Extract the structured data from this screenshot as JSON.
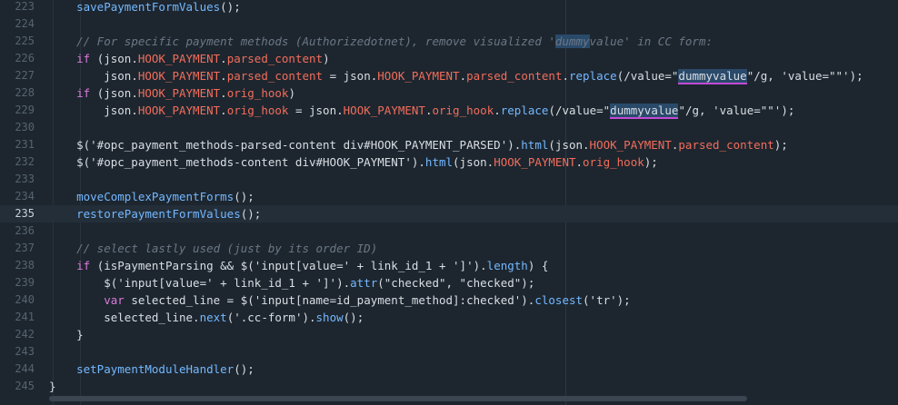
{
  "editor": {
    "lines": [
      {
        "num": "223",
        "tokens": [
          [
            "pn",
            "    "
          ],
          [
            "fn",
            "savePaymentFormValues"
          ],
          [
            "pn",
            "();"
          ]
        ]
      },
      {
        "num": "224",
        "tokens": []
      },
      {
        "num": "225",
        "tokens": [
          [
            "pn",
            "    "
          ],
          [
            "cm",
            "// For specific payment methods (Authorizedotnet), remove visualized '"
          ],
          [
            "cm-hl",
            "dummy"
          ],
          [
            "cm",
            "value' in CC form:"
          ]
        ]
      },
      {
        "num": "226",
        "tokens": [
          [
            "pn",
            "    "
          ],
          [
            "kw",
            "if"
          ],
          [
            "pn",
            " (json."
          ],
          [
            "prop",
            "HOOK_PAYMENT"
          ],
          [
            "pn",
            "."
          ],
          [
            "prop",
            "parsed_content"
          ],
          [
            "pn",
            ")"
          ]
        ]
      },
      {
        "num": "227",
        "tokens": [
          [
            "pn",
            "        json."
          ],
          [
            "prop",
            "HOOK_PAYMENT"
          ],
          [
            "pn",
            "."
          ],
          [
            "prop",
            "parsed_content"
          ],
          [
            "pn",
            " = json."
          ],
          [
            "prop",
            "HOOK_PAYMENT"
          ],
          [
            "pn",
            "."
          ],
          [
            "prop",
            "parsed_content"
          ],
          [
            "pn",
            "."
          ],
          [
            "fn",
            "replace"
          ],
          [
            "pn",
            "(/value=\""
          ],
          [
            "sq",
            "dummyvalue"
          ],
          [
            "pn",
            "\"/g, 'value=\"\"');"
          ]
        ]
      },
      {
        "num": "228",
        "tokens": [
          [
            "pn",
            "    "
          ],
          [
            "kw",
            "if"
          ],
          [
            "pn",
            " (json."
          ],
          [
            "prop",
            "HOOK_PAYMENT"
          ],
          [
            "pn",
            "."
          ],
          [
            "prop",
            "orig_hook"
          ],
          [
            "pn",
            ")"
          ]
        ]
      },
      {
        "num": "229",
        "tokens": [
          [
            "pn",
            "        json."
          ],
          [
            "prop",
            "HOOK_PAYMENT"
          ],
          [
            "pn",
            "."
          ],
          [
            "prop",
            "orig_hook"
          ],
          [
            "pn",
            " = json."
          ],
          [
            "prop",
            "HOOK_PAYMENT"
          ],
          [
            "pn",
            "."
          ],
          [
            "prop",
            "orig_hook"
          ],
          [
            "pn",
            "."
          ],
          [
            "fn",
            "replace"
          ],
          [
            "pn",
            "(/value=\""
          ],
          [
            "sq",
            "dummyvalue"
          ],
          [
            "pn",
            "\"/g, 'value=\"\"');"
          ]
        ]
      },
      {
        "num": "230",
        "tokens": []
      },
      {
        "num": "231",
        "tokens": [
          [
            "pn",
            "    $('#opc_payment_methods-parsed-content div#HOOK_PAYMENT_PARSED')."
          ],
          [
            "fn",
            "html"
          ],
          [
            "pn",
            "(json."
          ],
          [
            "prop",
            "HOOK_PAYMENT"
          ],
          [
            "pn",
            "."
          ],
          [
            "prop",
            "parsed_content"
          ],
          [
            "pn",
            ");"
          ]
        ]
      },
      {
        "num": "232",
        "tokens": [
          [
            "pn",
            "    $('#opc_payment_methods-content div#HOOK_PAYMENT')."
          ],
          [
            "fn",
            "html"
          ],
          [
            "pn",
            "(json."
          ],
          [
            "prop",
            "HOOK_PAYMENT"
          ],
          [
            "pn",
            "."
          ],
          [
            "prop",
            "orig_hook"
          ],
          [
            "pn",
            ");"
          ]
        ]
      },
      {
        "num": "233",
        "tokens": []
      },
      {
        "num": "234",
        "tokens": [
          [
            "pn",
            "    "
          ],
          [
            "fn",
            "moveComplexPaymentForms"
          ],
          [
            "pn",
            "();"
          ]
        ]
      },
      {
        "num": "235",
        "current": true,
        "tokens": [
          [
            "pn",
            "    "
          ],
          [
            "fn",
            "restorePaymentFormValues"
          ],
          [
            "pn",
            "();"
          ]
        ]
      },
      {
        "num": "236",
        "tokens": []
      },
      {
        "num": "237",
        "tokens": [
          [
            "pn",
            "    "
          ],
          [
            "cm",
            "// select lastly used (just by its order ID)"
          ]
        ]
      },
      {
        "num": "238",
        "tokens": [
          [
            "pn",
            "    "
          ],
          [
            "kw",
            "if"
          ],
          [
            "pn",
            " (isPaymentParsing && $('input[value=' + link_id_1 + ']')."
          ],
          [
            "fn",
            "length"
          ],
          [
            "pn",
            ") {"
          ]
        ]
      },
      {
        "num": "239",
        "tokens": [
          [
            "pn",
            "        $('input[value=' + link_id_1 + ']')."
          ],
          [
            "fn",
            "attr"
          ],
          [
            "pn",
            "(\"checked\", \"checked\");"
          ]
        ]
      },
      {
        "num": "240",
        "tokens": [
          [
            "pn",
            "        "
          ],
          [
            "kw",
            "var"
          ],
          [
            "pn",
            " selected_line = $('input[name=id_payment_method]:checked')."
          ],
          [
            "fn",
            "closest"
          ],
          [
            "pn",
            "('tr');"
          ]
        ]
      },
      {
        "num": "241",
        "tokens": [
          [
            "pn",
            "        selected_line."
          ],
          [
            "fn",
            "next"
          ],
          [
            "pn",
            "('.cc-form')."
          ],
          [
            "fn",
            "show"
          ],
          [
            "pn",
            "();"
          ]
        ]
      },
      {
        "num": "242",
        "tokens": [
          [
            "pn",
            "    }"
          ]
        ]
      },
      {
        "num": "243",
        "tokens": []
      },
      {
        "num": "244",
        "tokens": [
          [
            "pn",
            "    "
          ],
          [
            "fn",
            "setPaymentModuleHandler"
          ],
          [
            "pn",
            "();"
          ]
        ]
      },
      {
        "num": "245",
        "tokens": [
          [
            "pn",
            "}"
          ]
        ]
      }
    ]
  }
}
